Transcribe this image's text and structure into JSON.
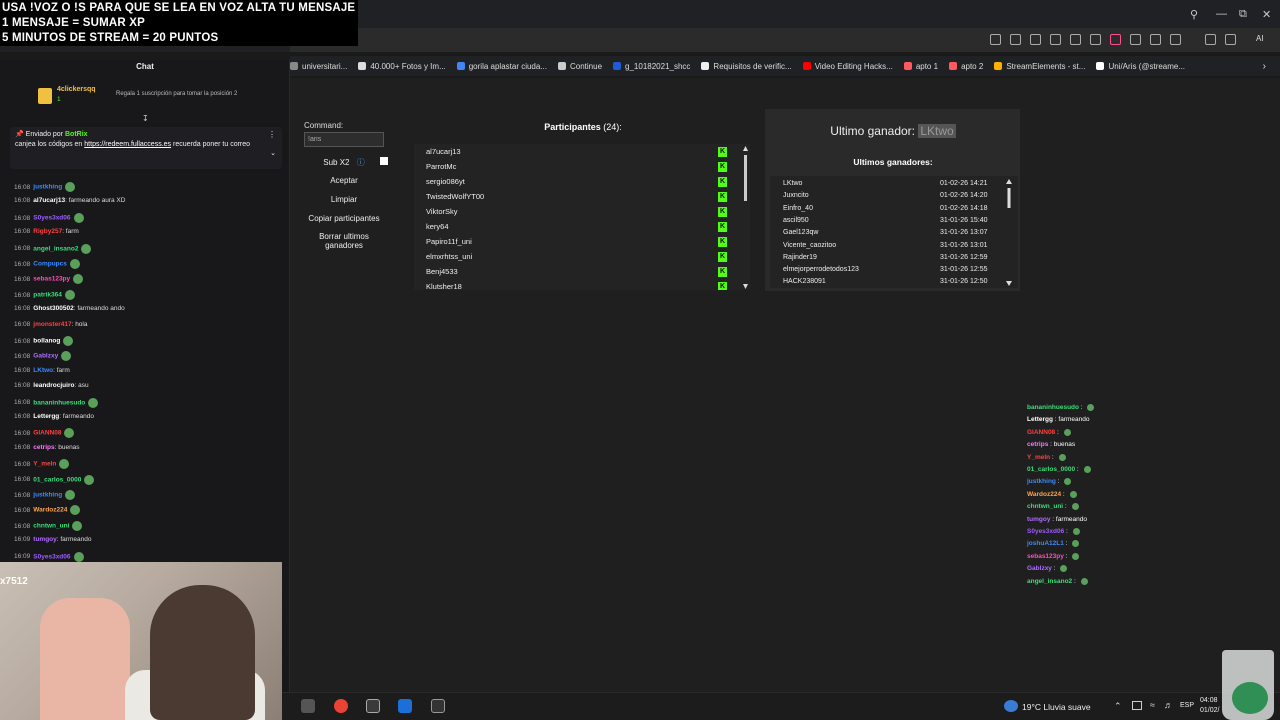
{
  "overlay": {
    "line1": "USA !VOZ O !S PARA QUE SE LEA EN VOZ ALTA TU MENSAJE",
    "line2": "1 MENSAJE = SUMAR XP",
    "line3": "5 MINUTOS DE STREAM = 20 PUNTOS"
  },
  "bookmarks": [
    {
      "label": "universitari...",
      "color": "#888"
    },
    {
      "label": "40.000+ Fotos y Im...",
      "color": "#ddd"
    },
    {
      "label": "gorila aplastar ciuda...",
      "color": "#4285f4"
    },
    {
      "label": "Continue",
      "color": "#ccc"
    },
    {
      "label": "g_10182021_shcc",
      "color": "#1e5bd6"
    },
    {
      "label": "Requisitos de verific...",
      "color": "#eee"
    },
    {
      "label": "Video Editing Hacks...",
      "color": "#ff0000"
    },
    {
      "label": "apto 1",
      "color": "#ff5a5f"
    },
    {
      "label": "apto 2",
      "color": "#ff5a5f"
    },
    {
      "label": "StreamElements - st...",
      "color": "#ffb000"
    },
    {
      "label": "Uni/Aris (@streame...",
      "color": "#fff"
    }
  ],
  "chat": {
    "title": "Chat",
    "gift_user": "4clickersqq",
    "gift_count": "1",
    "gift_text": "Regala 1 suscripción para tomar la posición 2",
    "pinned_by_label": "Enviado por",
    "pinned_by": "BotRix",
    "pinned_text_before": "canjea los códigos en ",
    "pinned_link": "https://redeem.fullaccess.es",
    "pinned_text_after": " recuerda poner tu correo",
    "messages": [
      {
        "time": "16:08",
        "user": "justkhing",
        "color": "#3a8bff",
        "text": ""
      },
      {
        "time": "16:08",
        "user": "al7ucarj13",
        "color": "#ffffff",
        "text": ": farmeando aura XD"
      },
      {
        "time": "16:08",
        "user": "S0yes3xd06",
        "color": "#9b5cff",
        "text": ""
      },
      {
        "time": "16:08",
        "user": "Rigby257",
        "color": "#ff4040",
        "text": ": farm"
      },
      {
        "time": "16:08",
        "user": "angel_insano2",
        "color": "#3adf7a",
        "text": ""
      },
      {
        "time": "16:08",
        "user": "Compupcs",
        "color": "#3a8bff",
        "text": ""
      },
      {
        "time": "16:08",
        "user": "sebas123py",
        "color": "#ff4db8",
        "text": ""
      },
      {
        "time": "16:08",
        "user": "patrik364",
        "color": "#3adf7a",
        "text": ""
      },
      {
        "time": "16:08",
        "user": "Ghost300502",
        "color": "#ffffff",
        "text": ": farmeando ando"
      },
      {
        "time": "16:08",
        "user": "jmonster417",
        "color": "#ff4040",
        "text": ": hola"
      },
      {
        "time": "16:08",
        "user": "bollanog",
        "color": "#ffffff",
        "text": ""
      },
      {
        "time": "16:08",
        "user": "Gablzxy",
        "color": "#b06cff",
        "text": ""
      },
      {
        "time": "16:08",
        "user": "LKtwo",
        "color": "#3a8bff",
        "text": ": farm"
      },
      {
        "time": "16:08",
        "user": "leandrocjuiro",
        "color": "#ffffff",
        "text": ": asu"
      },
      {
        "time": "16:08",
        "user": "bananinhuesudo",
        "color": "#3adf7a",
        "text": ""
      },
      {
        "time": "16:08",
        "user": "Lettergg",
        "color": "#ffffff",
        "text": ": farmeando"
      },
      {
        "time": "16:08",
        "user": "GIANN08",
        "color": "#ff4040",
        "text": ""
      },
      {
        "time": "16:08",
        "user": "cetrips",
        "color": "#ff77ff",
        "text": ": buenas"
      },
      {
        "time": "16:08",
        "user": "Y_meln",
        "color": "#ff4040",
        "text": ""
      },
      {
        "time": "16:08",
        "user": "01_carlos_0000",
        "color": "#3adf7a",
        "text": ""
      },
      {
        "time": "16:08",
        "user": "justkhing",
        "color": "#3a8bff",
        "text": ""
      },
      {
        "time": "16:08",
        "user": "Wardoz224",
        "color": "#ffa64d",
        "text": ""
      },
      {
        "time": "16:08",
        "user": "chntwn_uni",
        "color": "#3adf7a",
        "text": ""
      },
      {
        "time": "16:09",
        "user": "tumgoy",
        "color": "#b06cff",
        "text": ": farmeando"
      },
      {
        "time": "16:09",
        "user": "S0yes3xd06",
        "color": "#9b5cff",
        "text": ""
      }
    ]
  },
  "webcam": {
    "label": "x7512"
  },
  "app": {
    "command_label": "Command:",
    "command_value": "!aris",
    "buttons": {
      "sub": "Sub X2",
      "accept": "Aceptar",
      "clear": "Limpiar",
      "copy": "Copiar participantes",
      "delete_line1": "Borrar ultimos",
      "delete_line2": "ganadores"
    },
    "participants_label": "Participantes",
    "participants_count": "(24):",
    "participants": [
      "al7ucarj13",
      "ParrotMc",
      "sergio086yt",
      "TwistedWolfYT00",
      "ViktorSky",
      "kery64",
      "Papiro11f_uni",
      "elmxrhtss_uni",
      "Benj4533",
      "Klutsher18"
    ],
    "last_winner_label": "Ultimo ganador:",
    "last_winner_name": "LKtwo",
    "winners_label": "Ultimos ganadores:",
    "winners": [
      {
        "name": "LKtwo",
        "date": "01-02-26 14:21"
      },
      {
        "name": "Juxncito",
        "date": "01-02-26 14:20"
      },
      {
        "name": "Einfro_40",
        "date": "01-02-26 14:18"
      },
      {
        "name": "ascil950",
        "date": "31-01-26 15:40"
      },
      {
        "name": "Gael123qw",
        "date": "31-01-26 13:07"
      },
      {
        "name": "Vicente_caozitoo",
        "date": "31-01-26 13:01"
      },
      {
        "name": "Rajinder19",
        "date": "31-01-26 12:59"
      },
      {
        "name": "elmejorperrodetodos123",
        "date": "31-01-26 12:55"
      },
      {
        "name": "HACK238091",
        "date": "31-01-26 12:50"
      }
    ]
  },
  "right_chat": [
    {
      "user": "bananinhuesudo",
      "color": "#3adf7a",
      "text": ""
    },
    {
      "user": "Lettergg",
      "color": "#ffffff",
      "text": "farmeando"
    },
    {
      "user": "GIANN08",
      "color": "#ff4040",
      "text": ""
    },
    {
      "user": "cetrips",
      "color": "#ff77ff",
      "text": "buenas"
    },
    {
      "user": "Y_meln",
      "color": "#ff4040",
      "text": ""
    },
    {
      "user": "01_carlos_0000",
      "color": "#3adf7a",
      "text": ""
    },
    {
      "user": "justkhing",
      "color": "#3a8bff",
      "text": ""
    },
    {
      "user": "Wardoz224",
      "color": "#ffa64d",
      "text": ""
    },
    {
      "user": "chntwn_uni",
      "color": "#3adf7a",
      "text": ""
    },
    {
      "user": "tumgoy",
      "color": "#b06cff",
      "text": "farmeando"
    },
    {
      "user": "S0yes3xd06",
      "color": "#9b5cff",
      "text": ""
    },
    {
      "user": "joshuA12L1",
      "color": "#3a8bff",
      "text": ""
    },
    {
      "user": "sebas123py",
      "color": "#ff4db8",
      "text": ""
    },
    {
      "user": "Gablzxy",
      "color": "#b06cff",
      "text": ""
    },
    {
      "user": "angel_insano2",
      "color": "#3adf7a",
      "text": ""
    }
  ],
  "taskbar": {
    "weather": "19°C  Lluvia suave",
    "lang": "ESP",
    "time": "04:08",
    "date": "01/02/"
  },
  "colors": {
    "kick_green": "#53fc18",
    "accent": "#efeff1"
  }
}
